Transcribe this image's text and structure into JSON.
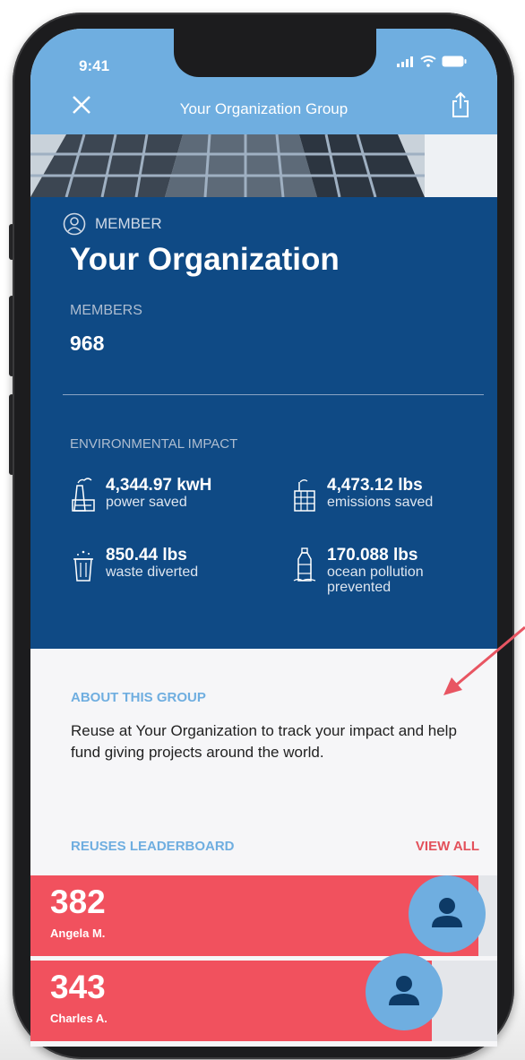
{
  "status_bar": {
    "time": "9:41"
  },
  "header": {
    "title": "Your Organization Group",
    "close_icon": "close-icon",
    "share_icon": "share-icon"
  },
  "card": {
    "member_label": "MEMBER",
    "org_name": "Your Organization",
    "members_label": "MEMBERS",
    "members_value": "968",
    "env_label": "ENVIRONMENTAL IMPACT",
    "stats": [
      {
        "value": "4,344.97 kwH",
        "desc1": "power saved",
        "desc2": "",
        "icon": "power-plant-icon"
      },
      {
        "value": "4,473.12 lbs",
        "desc1": "emissions saved",
        "desc2": "",
        "icon": "factory-icon"
      },
      {
        "value": "850.44 lbs",
        "desc1": "waste diverted",
        "desc2": "",
        "icon": "trash-bin-icon"
      },
      {
        "value": "170.088 lbs",
        "desc1": "ocean pollution",
        "desc2": "prevented",
        "icon": "bottle-icon"
      }
    ]
  },
  "about": {
    "title": "ABOUT THIS GROUP",
    "text": "Reuse at Your Organization to track your impact and help fund giving projects around the world."
  },
  "leaderboard": {
    "title": "REUSES LEADERBOARD",
    "view_all": "VIEW ALL",
    "entries": [
      {
        "score": "382",
        "name": "Angela M.",
        "bar_fraction": 0.96
      },
      {
        "score": "343",
        "name": "Charles A.",
        "bar_fraction": 0.86
      }
    ]
  },
  "colors": {
    "header": "#6faee0",
    "card": "#0f4a85",
    "accent_red": "#f1515e",
    "accent_blue": "#6faee0"
  }
}
